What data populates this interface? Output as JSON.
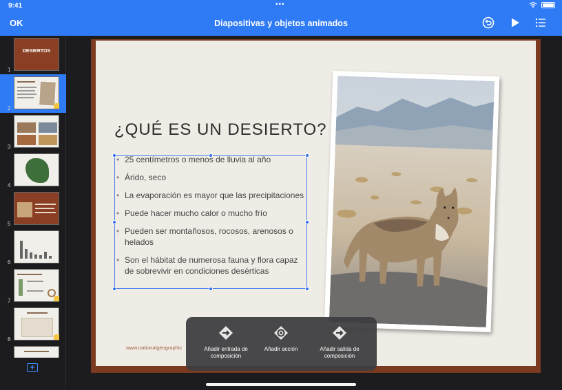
{
  "status": {
    "time": "9:41",
    "dots": "•••"
  },
  "toolbar": {
    "ok_label": "OK",
    "title": "Diapositivas y objetos animados"
  },
  "sidebar": {
    "slides": [
      {
        "number": "1",
        "label": "DESIERTOS"
      },
      {
        "number": "2"
      },
      {
        "number": "3"
      },
      {
        "number": "4"
      },
      {
        "number": "5"
      },
      {
        "number": "6"
      },
      {
        "number": "7"
      },
      {
        "number": "8"
      }
    ],
    "add_label": "+"
  },
  "slide": {
    "title": "¿QUÉ ES UN DESIERTO?",
    "bullets": [
      "25 centímetros o menos de lluvia al año",
      "Árido, seco",
      "La evaporación es mayor que las precipitaciones",
      "Puede hacer mucho calor o mucho frío",
      "Pueden ser montañosos, rocosos, arenosos o helados",
      "Son el hábitat de numerosa fauna y flora capaz de sobrevivir en condiciones desérticas"
    ],
    "footer": "www.nationalgeographic"
  },
  "popup": {
    "items": [
      {
        "label": "Añadir entrada de composición"
      },
      {
        "label": "Añadir acción"
      },
      {
        "label": "Añadir salida de composición"
      }
    ]
  },
  "colors": {
    "accent": "#2f7bf6",
    "slide_border": "#7a3b20",
    "selection": "#4a7cf0"
  }
}
